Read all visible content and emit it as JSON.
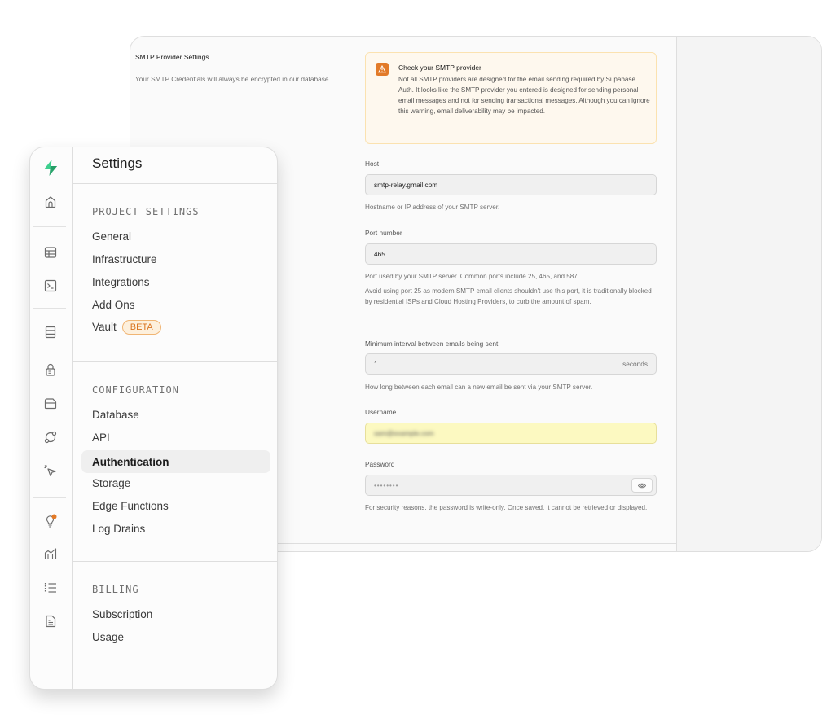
{
  "smtp": {
    "section_title": "SMTP Provider Settings",
    "section_description": "Your SMTP Credentials will always be encrypted in our database.",
    "alert": {
      "icon": "warning-triangle-icon",
      "title": "Check your SMTP provider",
      "body": "Not all SMTP providers are designed for the email sending required by Supabase Auth. It looks like the SMTP provider you entered is designed for sending personal email messages and not for sending transactional messages. Although you can ignore this warning, email deliverability may be impacted.",
      "color": "#e27a28"
    },
    "host": {
      "label": "Host",
      "value": "smtp-relay.gmail.com",
      "help": "Hostname or IP address of your SMTP server."
    },
    "port": {
      "label": "Port number",
      "value": "465",
      "help": "Port used by your SMTP server. Common ports include 25, 465, and 587.",
      "help_extra": "Avoid using port 25 as modern SMTP email clients shouldn't use this port, it is traditionally blocked by residential ISPs and Cloud Hosting Providers, to curb the amount of spam."
    },
    "interval": {
      "label": "Minimum interval between emails being sent",
      "value": "1",
      "suffix": "seconds",
      "help": "How long between each email can a new email be sent via your SMTP server."
    },
    "username": {
      "label": "Username",
      "value": "sam@example.com",
      "blurred": true
    },
    "password": {
      "label": "Password",
      "value": "••••••••",
      "toggle_icon": "eye-icon",
      "help": "For security reasons, the password is write-only. Once saved, it cannot be retrieved or displayed."
    }
  },
  "sidebar": {
    "logo": "supabase-logo-icon",
    "rail_icons": [
      "home-icon",
      "table-editor-icon",
      "sql-editor-icon",
      "database-icon",
      "auth-lock-icon",
      "storage-icon",
      "realtime-icon",
      "edge-functions-icon",
      "advisors-icon",
      "reports-icon",
      "logs-icon",
      "api-docs-icon"
    ],
    "title": "Settings",
    "sections": [
      {
        "title": "PROJECT SETTINGS",
        "items": [
          {
            "label": "General"
          },
          {
            "label": "Infrastructure"
          },
          {
            "label": "Integrations"
          },
          {
            "label": "Add Ons"
          },
          {
            "label": "Vault",
            "badge": "BETA"
          }
        ]
      },
      {
        "title": "CONFIGURATION",
        "items": [
          {
            "label": "Database"
          },
          {
            "label": "API"
          },
          {
            "label": "Authentication",
            "active": true
          },
          {
            "label": "Storage"
          },
          {
            "label": "Edge Functions"
          },
          {
            "label": "Log Drains"
          }
        ]
      },
      {
        "title": "BILLING",
        "items": [
          {
            "label": "Subscription"
          },
          {
            "label": "Usage"
          }
        ]
      }
    ],
    "brand_color": "#3ecf8e",
    "notification_dot_color": "#e27a28"
  }
}
